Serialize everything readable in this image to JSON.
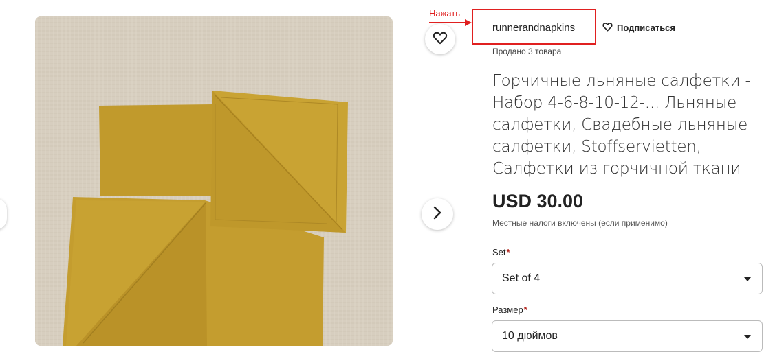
{
  "annotation": {
    "label": "Нажать",
    "color": "#e02020"
  },
  "shop": {
    "name": "runnerandnapkins",
    "follow_label": "Подписаться",
    "sold_text": "Продано 3 товара"
  },
  "product": {
    "title_lines": [
      "Горчичные льняные салфетки -",
      "Набор 4-6-8-10-12-... Льняные",
      "салфетки, Свадебные льняные",
      "салфетки, Stoffservietten,",
      "Салфетки из горчичной ткани"
    ],
    "price": "USD 30.00",
    "tax_note": "Местные налоги включены (если применимо)"
  },
  "options": {
    "set": {
      "label": "Set",
      "required_mark": "*",
      "selected": "Set of 4"
    },
    "size": {
      "label": "Размер",
      "required_mark": "*",
      "selected": "10 дюймов"
    }
  },
  "icons": {
    "favorite": "heart-icon",
    "follow": "heart-outline-icon",
    "next": "chevron-right-icon",
    "dropdown": "caret-down-icon"
  },
  "colors": {
    "accent_red": "#e02020",
    "napkin": "#c9a12e",
    "linen_bg": "#d6cdbd"
  }
}
